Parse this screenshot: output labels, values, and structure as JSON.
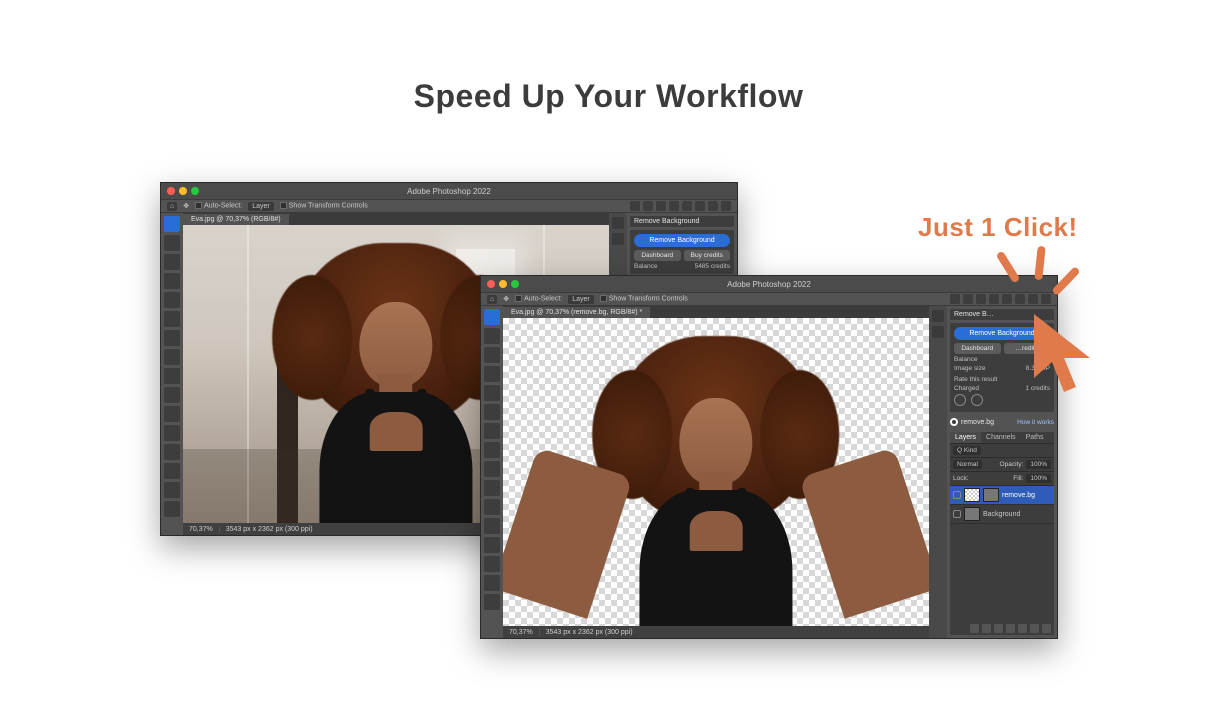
{
  "headline": "Speed Up Your Workflow",
  "callout": "Just 1 Click!",
  "app_title": "Adobe Photoshop 2022",
  "optbar": {
    "auto_select": "Auto-Select:",
    "auto_select_value": "Layer",
    "show_transform": "Show Transform Controls"
  },
  "win1": {
    "doc_tab": "Eva.jpg @ 70,37% (RGB/8#)",
    "status_zoom": "70,37%",
    "status_dims": "3543 px x 2362 px (300 ppi)",
    "panel_title": "Remove Background",
    "remove_btn": "Remove Background",
    "dashboard_btn": "Dashboard",
    "buy_btn": "Buy credits",
    "balance_label": "Balance",
    "balance_value": "5485 credits"
  },
  "win2": {
    "doc_tab": "Eva.jpg @ 70,37% (remove.bg, RGB/8#) *",
    "status_zoom": "70,37%",
    "status_dims": "3543 px x 2362 px (300 ppi)",
    "panel_title": "Remove B…",
    "remove_btn": "Remove Background",
    "dashboard_btn": "Dashboard",
    "buy_btn": "…redits",
    "balance_label": "Balance",
    "image_size_label": "Image size",
    "image_size_value": "8.37 MP",
    "rate_label": "Rate this result",
    "charged_label": "Charged",
    "charged_value": "1 credits",
    "brand": "remove.bg",
    "brand_link": "How it works",
    "layers_tab": "Layers",
    "channels_tab": "Channels",
    "paths_tab": "Paths",
    "kind_label": "Q Kind",
    "blend_mode": "Normal",
    "opacity_label": "Opacity:",
    "opacity_value": "100%",
    "lock_label": "Lock:",
    "fill_label": "Fill:",
    "fill_value": "100%",
    "layer1_name": "remove.bg",
    "layer2_name": "Background"
  }
}
